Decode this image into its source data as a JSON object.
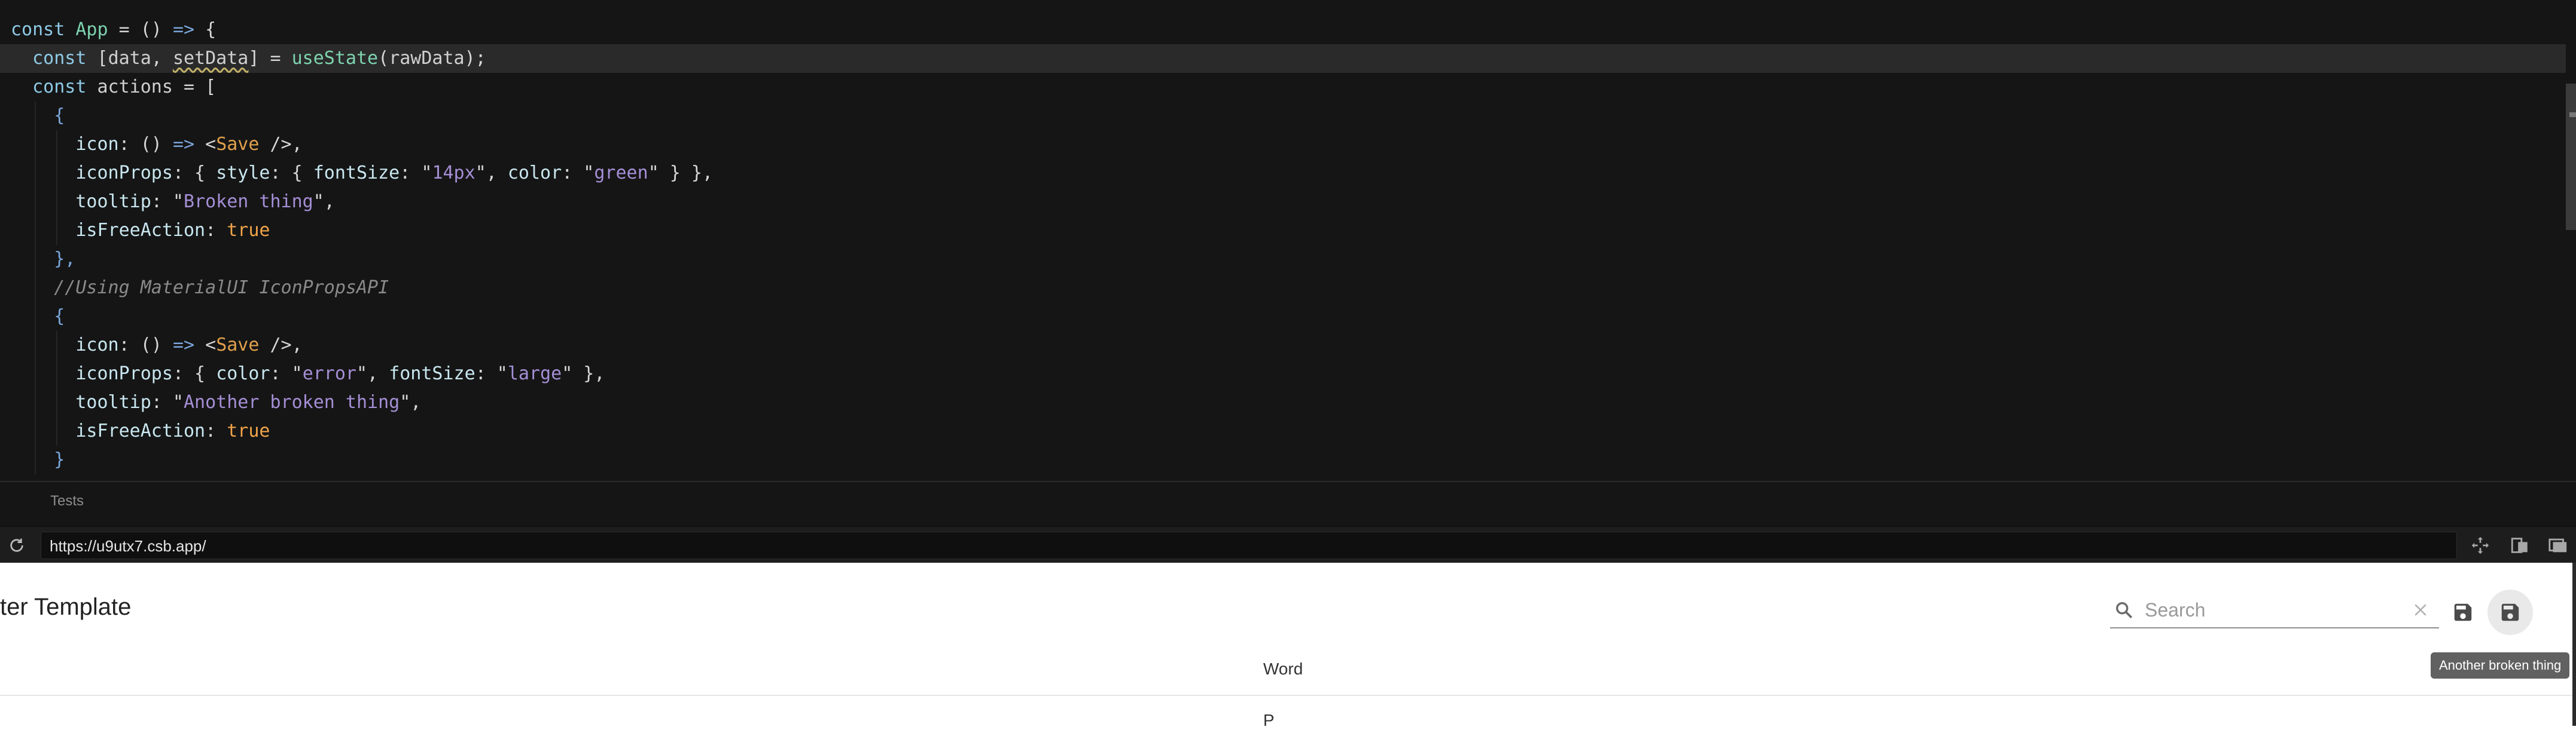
{
  "editor": {
    "lines": [
      [
        {
          "t": "const ",
          "c": "kw"
        },
        {
          "t": "App",
          "c": "fn"
        },
        {
          "t": " = () ",
          "c": "punc"
        },
        {
          "t": "=>",
          "c": "op"
        },
        {
          "t": " {",
          "c": "punc"
        }
      ],
      [
        {
          "t": "  const ",
          "c": "kw"
        },
        {
          "t": "[",
          "c": "punc"
        },
        {
          "t": "data",
          "c": "id"
        },
        {
          "t": ", ",
          "c": "punc"
        },
        {
          "t": "setData",
          "c": "id",
          "w": true
        },
        {
          "t": "] = ",
          "c": "punc"
        },
        {
          "t": "useState",
          "c": "fn"
        },
        {
          "t": "(",
          "c": "punc"
        },
        {
          "t": "rawData",
          "c": "id"
        },
        {
          "t": ");",
          "c": "punc"
        }
      ],
      [
        {
          "t": "  const ",
          "c": "kw"
        },
        {
          "t": "actions",
          "c": "id"
        },
        {
          "t": " = [",
          "c": "punc"
        }
      ],
      [
        {
          "t": "    {",
          "c": "op"
        }
      ],
      [
        {
          "t": "      icon",
          "c": "prop"
        },
        {
          "t": ": () ",
          "c": "punc"
        },
        {
          "t": "=>",
          "c": "op"
        },
        {
          "t": " <",
          "c": "punc"
        },
        {
          "t": "Save",
          "c": "comp"
        },
        {
          "t": " />,",
          "c": "punc"
        }
      ],
      [
        {
          "t": "      iconProps",
          "c": "prop"
        },
        {
          "t": ": { ",
          "c": "punc"
        },
        {
          "t": "style",
          "c": "prop"
        },
        {
          "t": ": { ",
          "c": "punc"
        },
        {
          "t": "fontSize",
          "c": "prop"
        },
        {
          "t": ": \"",
          "c": "punc"
        },
        {
          "t": "14px",
          "c": "str"
        },
        {
          "t": "\", ",
          "c": "punc"
        },
        {
          "t": "color",
          "c": "prop"
        },
        {
          "t": ": \"",
          "c": "punc"
        },
        {
          "t": "green",
          "c": "str"
        },
        {
          "t": "\" } },",
          "c": "punc"
        }
      ],
      [
        {
          "t": "      tooltip",
          "c": "prop"
        },
        {
          "t": ": \"",
          "c": "punc"
        },
        {
          "t": "Broken thing",
          "c": "str"
        },
        {
          "t": "\",",
          "c": "punc"
        }
      ],
      [
        {
          "t": "      isFreeAction",
          "c": "prop"
        },
        {
          "t": ": ",
          "c": "punc"
        },
        {
          "t": "true",
          "c": "bool"
        }
      ],
      [
        {
          "t": "    },",
          "c": "op"
        }
      ],
      [
        {
          "t": "    //Using MaterialUI IconPropsAPI",
          "c": "cmt"
        }
      ],
      [
        {
          "t": "    {",
          "c": "op"
        }
      ],
      [
        {
          "t": "      icon",
          "c": "prop"
        },
        {
          "t": ": () ",
          "c": "punc"
        },
        {
          "t": "=>",
          "c": "op"
        },
        {
          "t": " <",
          "c": "punc"
        },
        {
          "t": "Save",
          "c": "comp"
        },
        {
          "t": " />,",
          "c": "punc"
        }
      ],
      [
        {
          "t": "      iconProps",
          "c": "prop"
        },
        {
          "t": ": { ",
          "c": "punc"
        },
        {
          "t": "color",
          "c": "prop"
        },
        {
          "t": ": \"",
          "c": "punc"
        },
        {
          "t": "error",
          "c": "str"
        },
        {
          "t": "\", ",
          "c": "punc"
        },
        {
          "t": "fontSize",
          "c": "prop"
        },
        {
          "t": ": \"",
          "c": "punc"
        },
        {
          "t": "large",
          "c": "str"
        },
        {
          "t": "\" },",
          "c": "punc"
        }
      ],
      [
        {
          "t": "      tooltip",
          "c": "prop"
        },
        {
          "t": ": \"",
          "c": "punc"
        },
        {
          "t": "Another broken thing",
          "c": "str"
        },
        {
          "t": "\",",
          "c": "punc"
        }
      ],
      [
        {
          "t": "      isFreeAction",
          "c": "prop"
        },
        {
          "t": ": ",
          "c": "punc"
        },
        {
          "t": "true",
          "c": "bool"
        }
      ],
      [
        {
          "t": "    }",
          "c": "op"
        }
      ]
    ],
    "active_line": 1
  },
  "tests_tab": {
    "label": "Tests"
  },
  "browser": {
    "url": "https://u9utx7.csb.app/"
  },
  "preview": {
    "title": "ter Template",
    "search": {
      "placeholder": "Search",
      "value": ""
    },
    "tooltip": "Another broken thing",
    "column_header": "Word",
    "row_partial": "P"
  },
  "colors": {
    "editor_bg": "#151515",
    "string": "#a58fd6",
    "component": "#e0a04c",
    "tooltip_bg": "#616161"
  }
}
